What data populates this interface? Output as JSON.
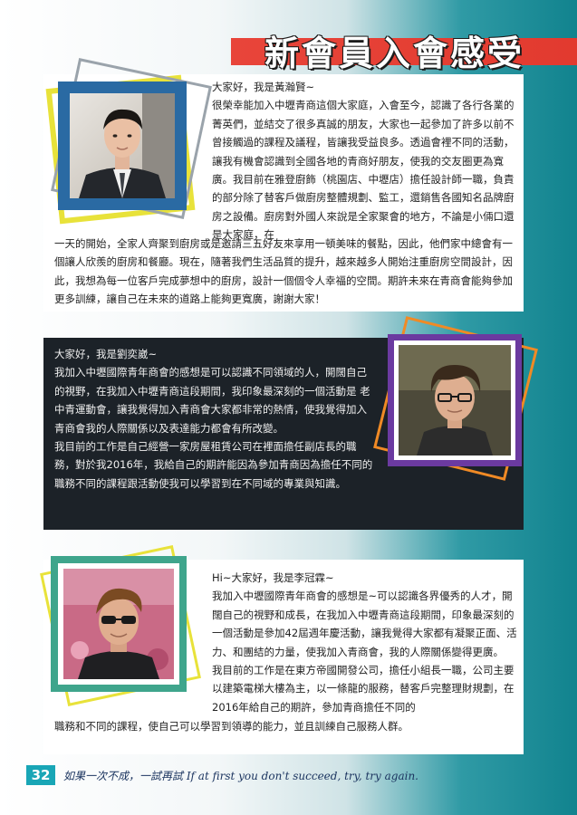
{
  "page": {
    "title": "新會員入會感受",
    "page_number": "32",
    "footer_quote": "如果一次不成，一試再試 If at first you don't succeed, try, try again."
  },
  "colors": {
    "title_band": "#e8453a",
    "teal": "#11838e",
    "card2_bg": "#1c2228",
    "frame1": "#2a6aa3",
    "frame2": "#6b3aa0",
    "frame3": "#3fa58c",
    "accent_yellow": "#e8e23a",
    "accent_orange": "#f08a25"
  },
  "members": [
    {
      "name": "黃瀚賢",
      "photo": "portrait-man-suit",
      "greeting": "大家好，我是黃瀚賢~",
      "text_top": "很榮幸能加入中壢青商這個大家庭，入會至今，認識了各行各業的菁英們，並結交了很多真誠的朋友，大家也一起參加了許多以前不曾接觸過的課程及議程，皆讓我受益良多。透過會裡不同的活動，讓我有機會認識到全國各地的青商好朋友，使我的交友圈更為寬廣。我目前在雅登廚飾（桃園店、中壢店）擔任設計師一職，負責的部分除了替客戶做廚房整體規劃、監工，還銷售各國知名品牌廚房之設備。廚房對外國人來說是全家聚會的地方，不論是小倆口還是大家庭，在",
      "text_bottom": "一天的開始，全家人齊聚到廚房或是邀請三五好友來享用一頓美味的餐點，因此，他們家中總會有一個讓人欣羨的廚房和餐廳。現在，隨著我們生活品質的提升，越來越多人開始注重廚房空間設計，因此，我想為每一位客戶完成夢想中的廚房，設計一個個令人幸福的空間。期許未來在青商會能夠參加更多訓練，讓自己在未來的道路上能夠更寬廣，謝謝大家！"
    },
    {
      "name": "劉奕崴",
      "photo": "portrait-man-glasses",
      "greeting": "大家好，我是劉奕崴~",
      "text_top": "我加入中壢國際青年商會的感想是可以認識不同領域的人，開闊自己的視野，在我加入中壢青商這段期間，我印象最深刻的一個活動是 老中青運動會，讓我覺得加入青商會大家都非常的熱情，使我覺得加入青商會我的人際關係以及表達能力都會有所改變。",
      "text_bottom": "我目前的工作是自己經營一家房屋租賃公司在裡面擔任副店長的職務，對於我2016年，我給自己的期許能因為參加青商因為擔任不同的職務不同的課程跟活動使我可以學習到在不同域的專業與知識。"
    },
    {
      "name": "李冠霖",
      "photo": "portrait-man-sunglasses",
      "greeting": "Hi~大家好，我是李冠霖~",
      "text_top": "我加入中壢國際青年商會的感想是~可以認識各界優秀的人才，開闊自己的視野和成長，在我加入中壢青商這段期間，印象最深刻的一個活動是參加42屆週年慶活動，讓我覺得大家都有凝聚正面、活力、和團結的力量，使我加入青商會，我的人際關係變得更廣。",
      "text_top_2": "我目前的工作是在東方帝國開發公司，擔任小組長一職，公司主要以建築電梯大樓為主，以一條龍的服務，替客戶完整理財規劃，在2016年給自己的期許，參加青商擔任不同的",
      "text_bottom": "職務和不同的課程，使自己可以學習到領導的能力，並且訓練自己服務人群。"
    }
  ]
}
